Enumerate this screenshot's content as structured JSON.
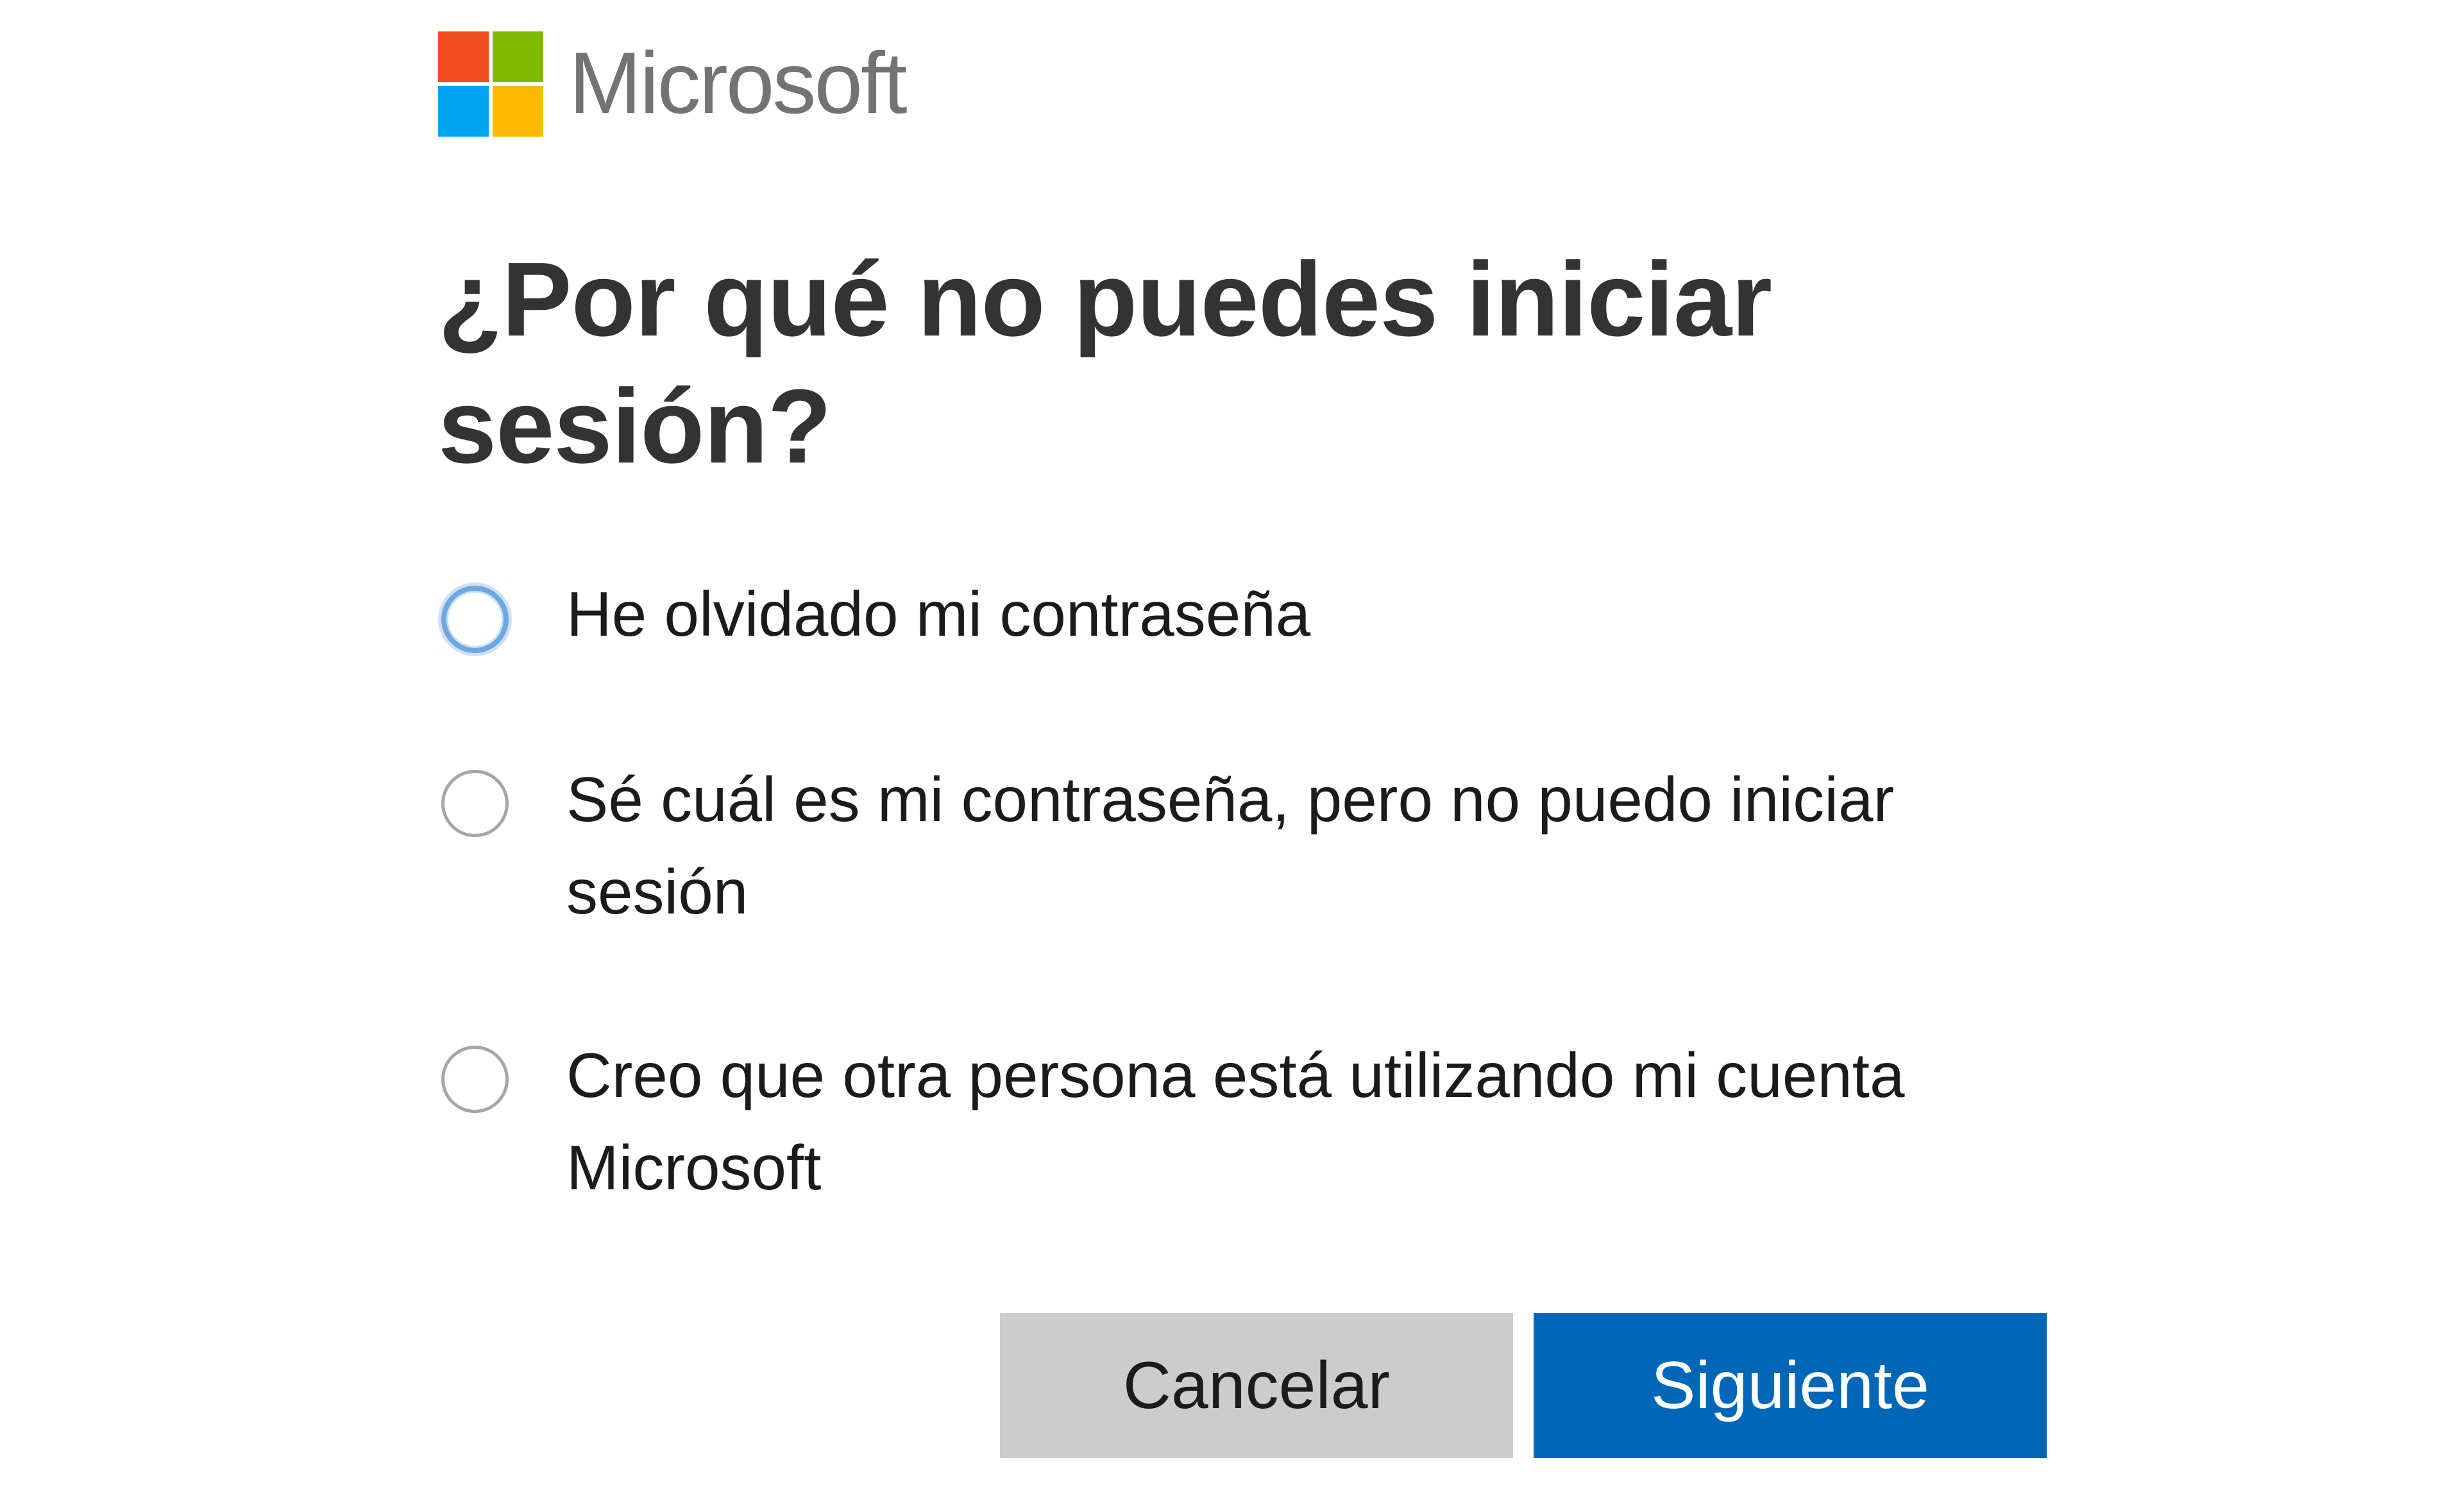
{
  "brand": {
    "name": "Microsoft",
    "logo_colors": [
      "#f25022",
      "#7fba00",
      "#00a4ef",
      "#ffb900"
    ]
  },
  "page": {
    "title": "¿Por qué no puedes iniciar sesión?"
  },
  "options": [
    {
      "label": "He olvidado mi contraseña",
      "selected": false,
      "focused": true
    },
    {
      "label": "Sé cuál es mi contraseña, pero no puedo iniciar sesión",
      "selected": false,
      "focused": false
    },
    {
      "label": "Creo que otra persona está utilizando mi cuenta Microsoft",
      "selected": false,
      "focused": false
    }
  ],
  "buttons": {
    "cancel_label": "Cancelar",
    "next_label": "Siguiente"
  },
  "colors": {
    "primary_button": "#0067b8",
    "secondary_button": "#cccccc",
    "focus_ring": "#6fa8e0"
  }
}
